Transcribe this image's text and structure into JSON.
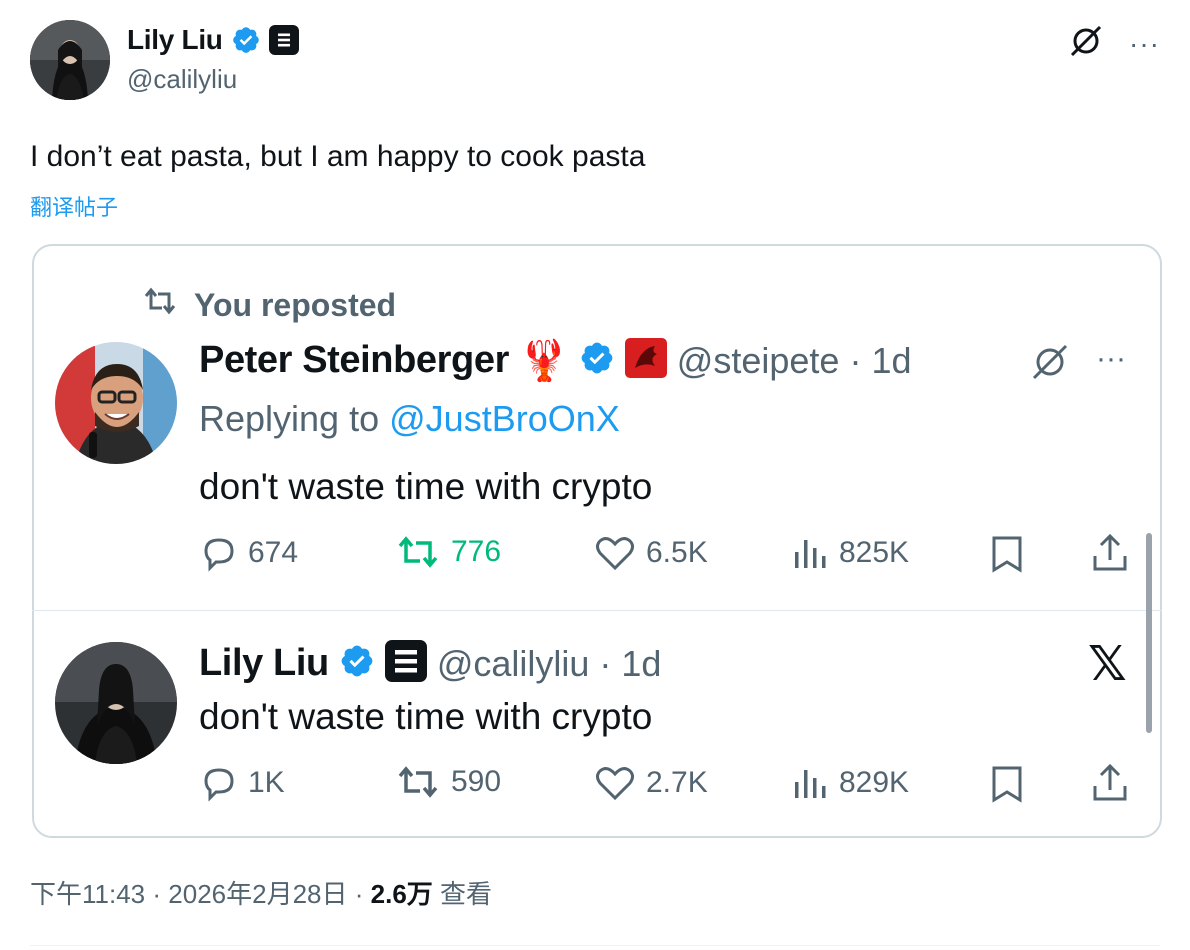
{
  "post": {
    "author_name": "Lily Liu",
    "author_handle": "@calilyliu",
    "text": "I don’t eat pasta, but I am happy to cook pasta",
    "translate_label": "翻译帖子",
    "more_label": "···"
  },
  "quote": {
    "repost_label": "You reposted",
    "reply": {
      "name": "Peter Steinberger",
      "emoji": "🦞",
      "handle": "@steipete",
      "dot": "·",
      "time": "1d",
      "replying_prefix": "Replying to",
      "replying_handle": "@JustBroOnX",
      "text": "don't waste time with crypto",
      "more_label": "···",
      "stats": {
        "replies": "674",
        "reposts": "776",
        "likes": "6.5K",
        "views": "825K"
      }
    },
    "original": {
      "name": "Lily Liu",
      "handle": "@calilyliu",
      "dot": "·",
      "time": "1d",
      "text": "don't waste time with crypto",
      "platform_logo": "𝕏",
      "stats": {
        "replies": "1K",
        "reposts": "590",
        "likes": "2.7K",
        "views": "829K"
      }
    }
  },
  "footer": {
    "time": "下午11:43",
    "sep1": "·",
    "date": "2026年2月28日",
    "sep2": "·",
    "views_count": "2.6万",
    "views_label": "查看"
  },
  "icons": {
    "verified": "verified-badge-icon",
    "grok": "grok-icon",
    "reply": "reply-icon",
    "repost": "repost-icon",
    "like": "like-icon",
    "views": "views-icon",
    "bookmark": "bookmark-icon",
    "share": "share-icon"
  },
  "colors": {
    "accent": "#1d9bf0",
    "secondary_text": "#536471",
    "repost_active": "#00ba7c",
    "border": "#cfd9de"
  }
}
